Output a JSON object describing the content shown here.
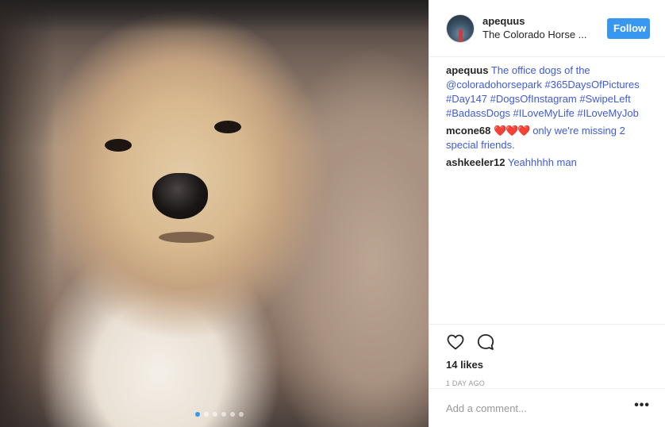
{
  "post": {
    "image_alt": "Scruffy tan and white terrier looking at camera",
    "carousel": {
      "count": 6,
      "active_index": 0
    }
  },
  "header": {
    "username": "apequus",
    "location": "The Colorado Horse ...",
    "follow_label": "Follow"
  },
  "comments": [
    {
      "user": "apequus",
      "text": "The office dogs of the @coloradohorsepark #365DaysOfPictures #Day147 #DogsOfInstagram #SwipeLeft #BadassDogs #ILoveMyLife #ILoveMyJob"
    },
    {
      "user": "mcone68",
      "hearts": "❤️❤️❤️",
      "text": "only we're missing 2 special friends."
    },
    {
      "user": "ashkeeler12",
      "text": "Yeahhhhh man"
    }
  ],
  "actions": {
    "likes": "14 likes",
    "time": "1 DAY AGO"
  },
  "comment_box": {
    "placeholder": "Add a comment...",
    "more_label": "•••"
  },
  "colors": {
    "accent": "#3897f0",
    "link": "#3f5bd6",
    "heart": "#e0332e"
  }
}
